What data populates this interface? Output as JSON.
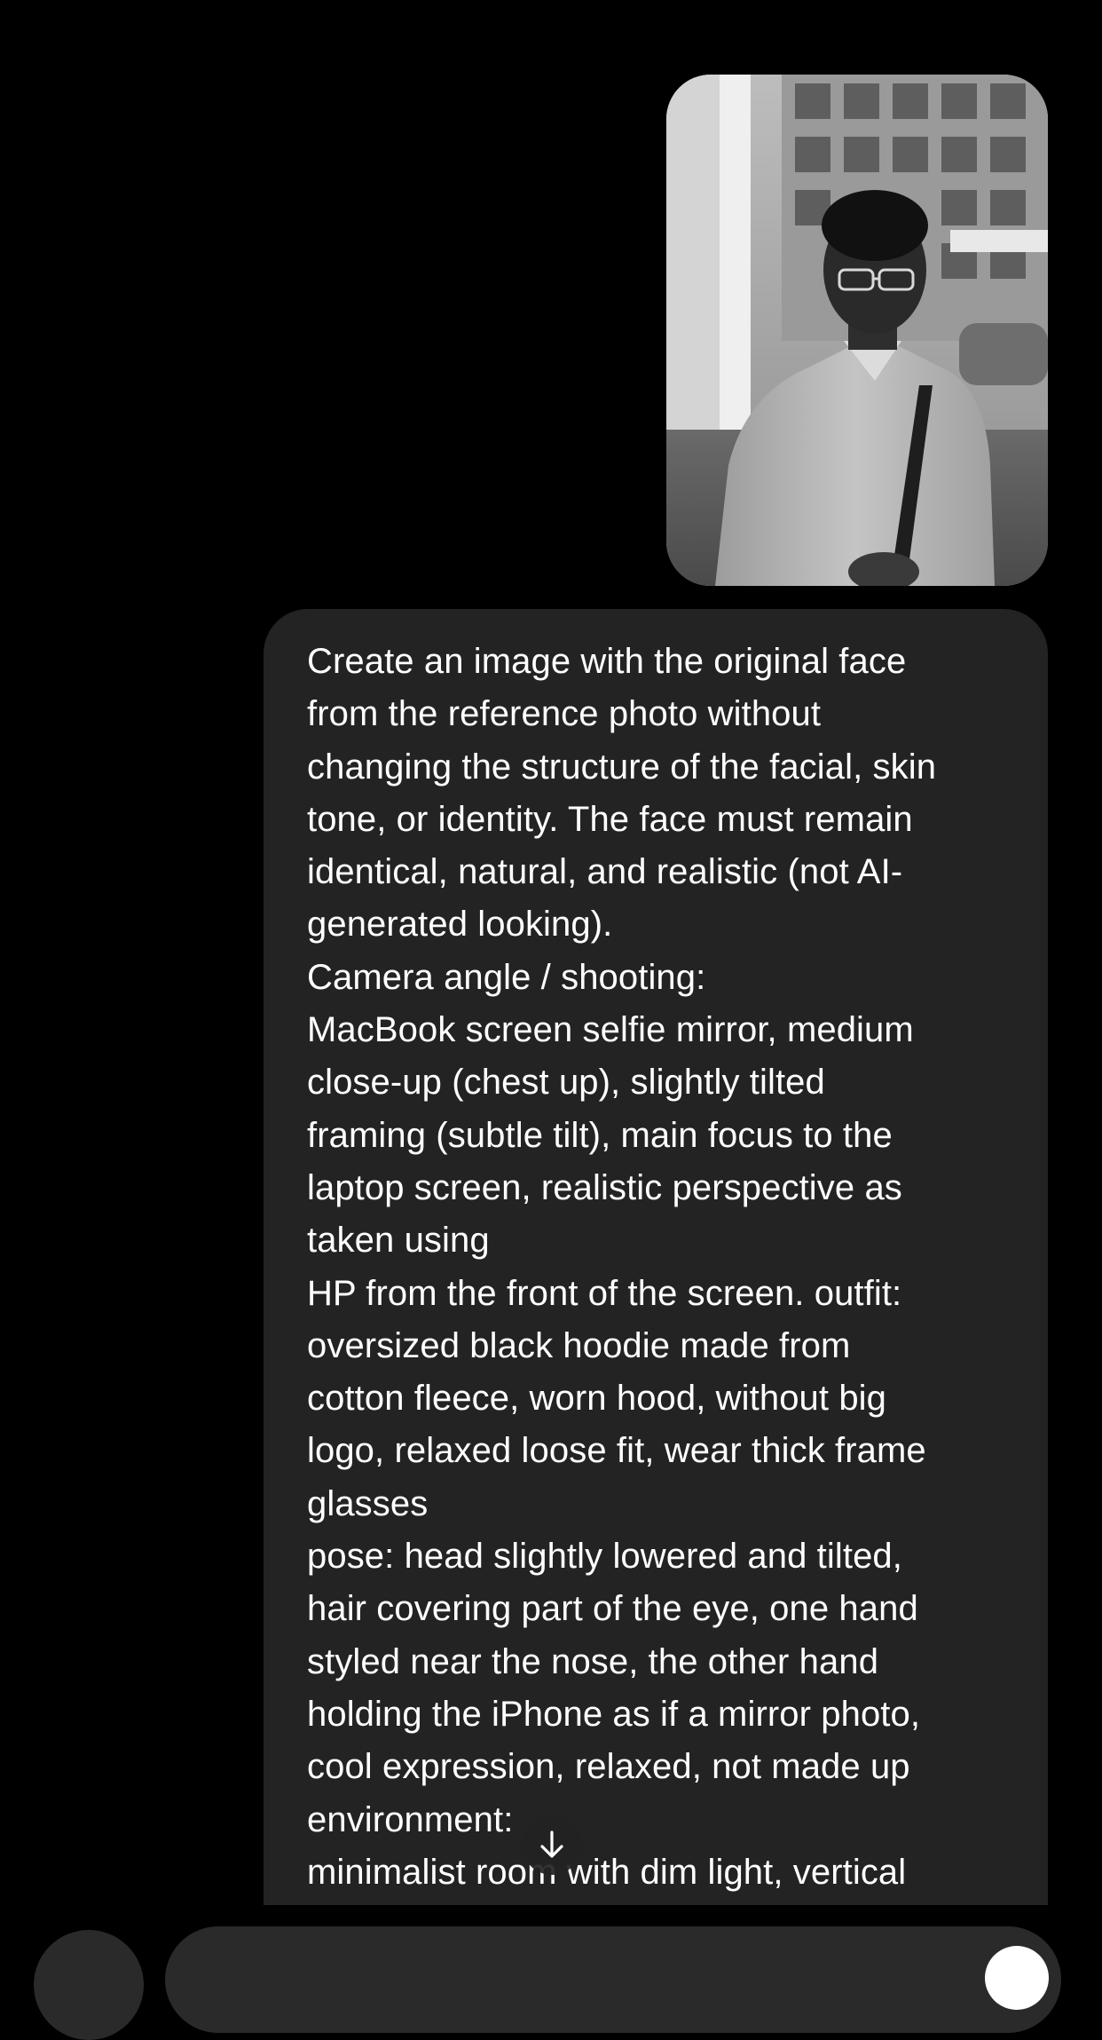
{
  "message": {
    "attachment_icon": "photo-thumbnail",
    "text": "Create an image with the original face\nfrom the reference photo without\nchanging the structure of the facial, skin\ntone, or identity. The face must remain\nidentical, natural, and realistic (not AI-\ngenerated looking).\nCamera angle / shooting:\nMacBook screen selfie mirror, medium\nclose-up (chest up), slightly tilted\nframing (subtle tilt), main focus to the\nlaptop screen, realistic perspective as\ntaken using\nHP from the front of the screen. outfit:\noversized black hoodie made from\ncotton fleece, worn hood, without big\nlogo, relaxed loose fit, wear thick frame\nglasses\npose: head slightly lowered and tilted,\nhair covering part of the eye, one hand\nstyled near the nose, the other hand\nholding the iPhone as if a mirror photo,\ncool expression, relaxed, not made up\nenvironment:\nminimalist room with dim light, vertical"
  },
  "scroll_button": {
    "icon": "arrow-down-icon"
  },
  "composer": {
    "left_icon": "plus-icon",
    "send_icon": "send-icon"
  },
  "colors": {
    "background": "#000000",
    "bubble": "#232323",
    "text": "#ffffff"
  }
}
